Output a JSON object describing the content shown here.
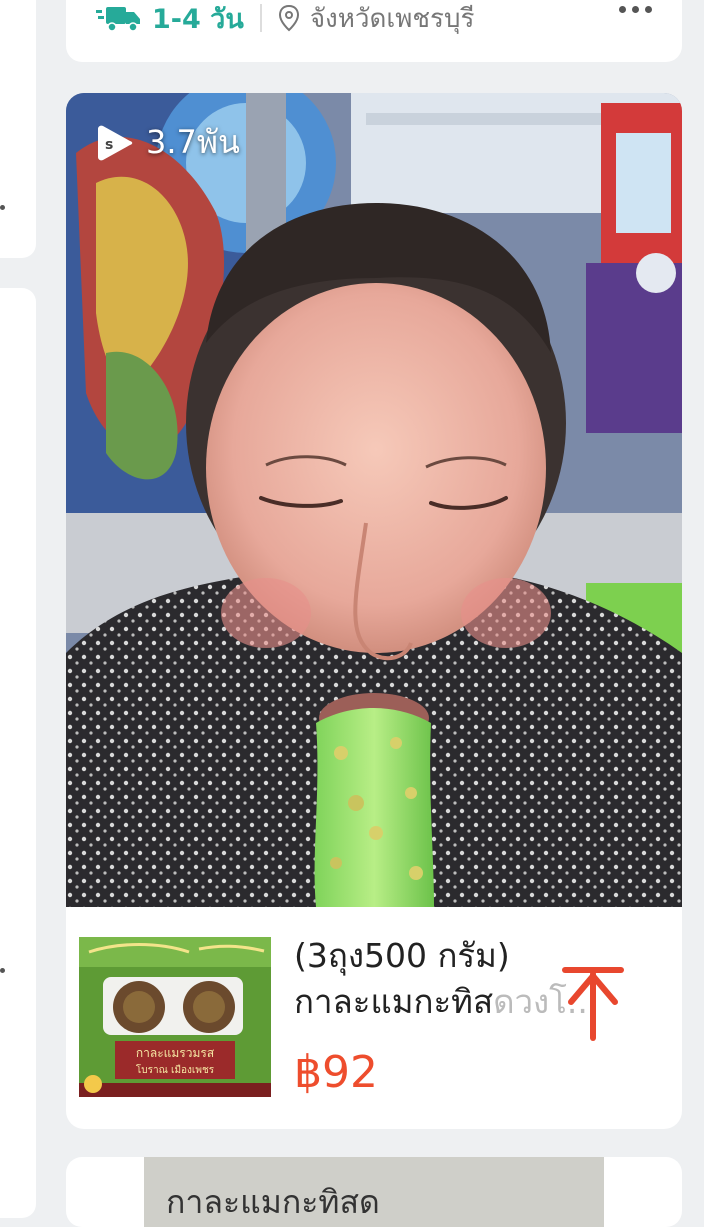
{
  "shipping": {
    "time": "1-4 วัน",
    "location": "จังหวัดเพชรบุรี",
    "icon": "truck-icon",
    "location_icon": "pin-icon"
  },
  "video": {
    "views": "3.7พัน",
    "icon": "shopee-video-icon"
  },
  "product": {
    "title_line1": "(3ถุง500 กรัม)",
    "title_line2": "กาละแมกะทิส",
    "title_faded": "ดวงโ...",
    "price": "฿92"
  },
  "thumbnail": {
    "label1": "กาละแมรวมรส",
    "label2": "โบราณ เมืองเพชร"
  },
  "next_card": {
    "text": "กาละแมกะทิสด"
  },
  "colors": {
    "brand_green": "#26aa99",
    "price": "#ee4d2d",
    "background": "#eef0f2"
  }
}
